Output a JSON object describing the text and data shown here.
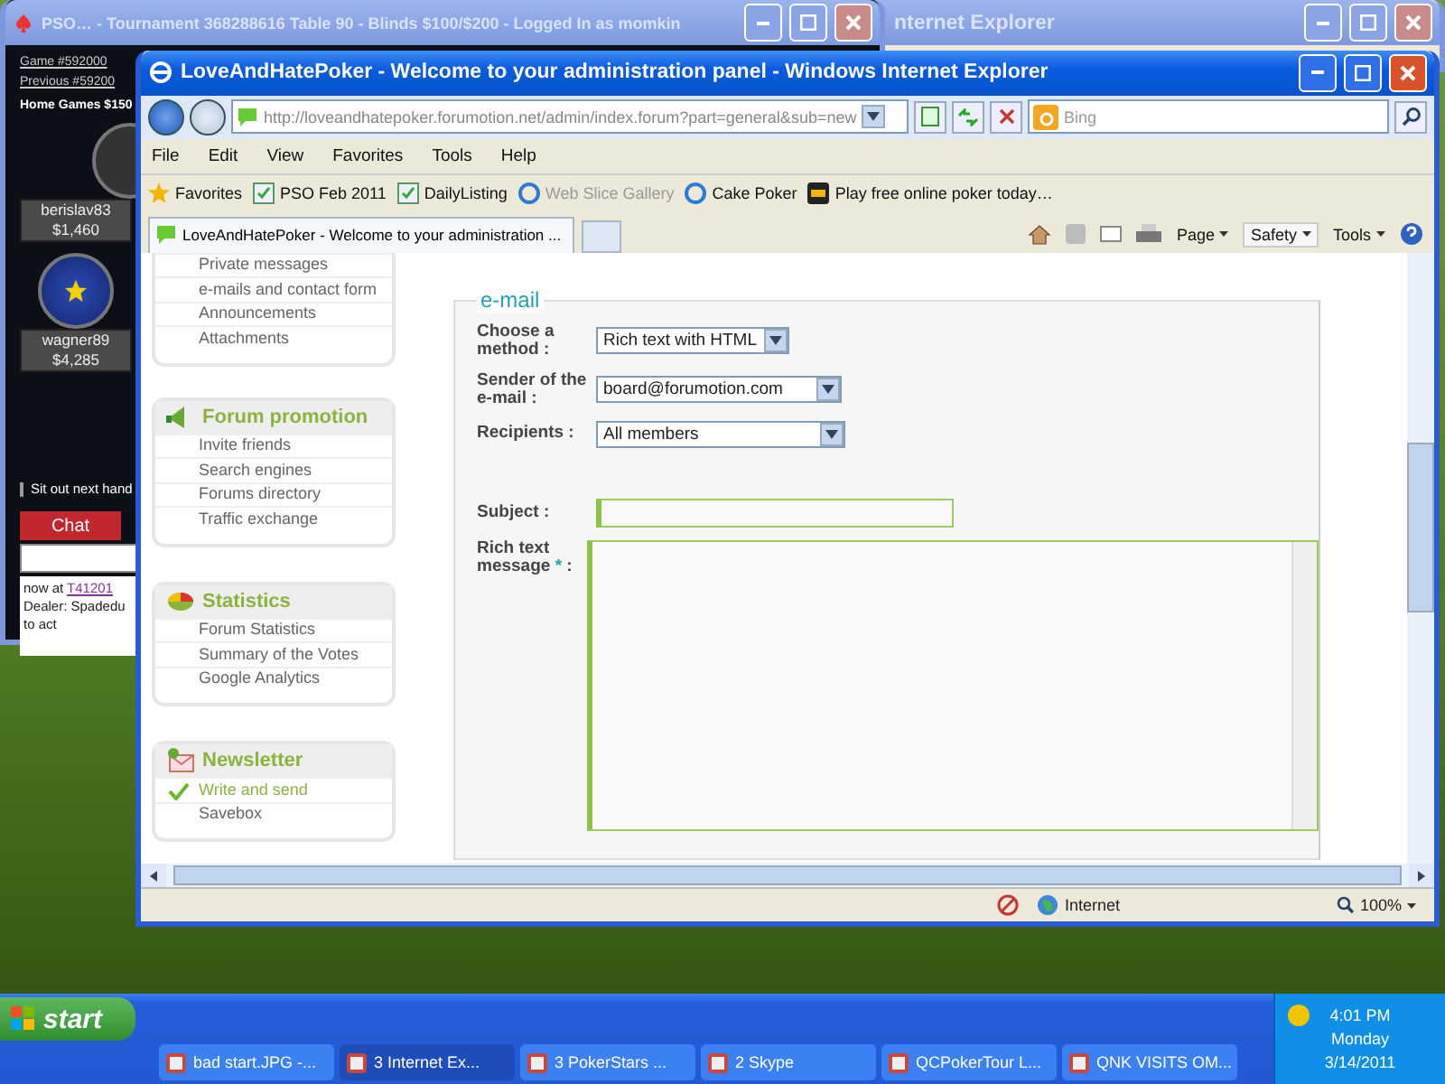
{
  "poker_window": {
    "title": "PSO… - Tournament 368288616 Table 90 - Blinds $100/$200 - Logged In as momkin",
    "active": false,
    "header_lines": [
      "Game  #592000",
      "Previous #59200"
    ],
    "table_name": "Home Games $150",
    "players": [
      {
        "name": "berislav83",
        "chips": "$1,460"
      },
      {
        "name": "wagner89",
        "chips": "$4,285"
      }
    ],
    "sit_out": {
      "label": "Sit out next hand",
      "checked": false
    },
    "chat_tab": "Chat",
    "chat_log": [
      {
        "text": "now at ",
        "link": "T41201"
      },
      {
        "text": "Dealer: Spadedu"
      },
      {
        "text": "to act"
      }
    ]
  },
  "back_window": {
    "title": "nternet Explorer",
    "active": false
  },
  "browser": {
    "title": "LoveAndHatePoker - Welcome to your administration panel - Windows Internet Explorer",
    "active": true,
    "address": "http://loveandhatepoker.forumotion.net/admin/index.forum?part=general&sub=new",
    "search_placeholder": "Bing",
    "menu": [
      "File",
      "Edit",
      "View",
      "Favorites",
      "Tools",
      "Help"
    ],
    "favorites": [
      {
        "label": "Favorites",
        "kind": "star",
        "disabled": false
      },
      {
        "label": "PSO Feb 2011",
        "kind": "feed",
        "disabled": false
      },
      {
        "label": "DailyListing",
        "kind": "feed",
        "disabled": false
      },
      {
        "label": "Web Slice Gallery",
        "kind": "page",
        "disabled": true
      },
      {
        "label": "Cake Poker",
        "kind": "page",
        "disabled": false
      },
      {
        "label": "Play free online poker today…",
        "kind": "logo",
        "disabled": false
      }
    ],
    "tab": {
      "label": "LoveAndHatePoker - Welcome to your administration ...",
      "selected": true
    },
    "commands": [
      "Page",
      "Safety",
      "Tools"
    ],
    "sidebar": [
      {
        "items": [
          {
            "label": "Private messages",
            "selected": false
          },
          {
            "label": "e-mails and contact form",
            "selected": false
          },
          {
            "label": "Announcements",
            "selected": false
          },
          {
            "label": "Attachments",
            "selected": false
          }
        ]
      },
      {
        "kind": "promotion",
        "title": "Forum promotion",
        "items": [
          {
            "label": "Invite friends",
            "selected": false
          },
          {
            "label": "Search engines",
            "selected": false
          },
          {
            "label": "Forums directory",
            "selected": false
          },
          {
            "label": "Traffic exchange",
            "selected": false
          }
        ]
      },
      {
        "kind": "statistics",
        "title": "Statistics",
        "items": [
          {
            "label": "Forum Statistics",
            "selected": false
          },
          {
            "label": "Summary of the Votes",
            "selected": false
          },
          {
            "label": "Google Analytics",
            "selected": false
          }
        ]
      },
      {
        "kind": "newsletter",
        "title": "Newsletter",
        "items": [
          {
            "label": "Write and send",
            "selected": true
          },
          {
            "label": "Savebox",
            "selected": false
          }
        ]
      }
    ],
    "form": {
      "legend": "e-mail",
      "fields": [
        {
          "kind": "select",
          "label": "Choose a method :",
          "value": "Rich text with HTML"
        },
        {
          "kind": "select",
          "label": "Sender of the e-mail :",
          "value": "board@forumotion.com"
        },
        {
          "kind": "select",
          "label": "Recipients :",
          "value": "All members"
        },
        {
          "kind": "input",
          "label": "Subject :"
        },
        {
          "kind": "textarea",
          "label": "Rich text message",
          "required_mark": "*",
          "suffix": ":"
        }
      ]
    },
    "status": {
      "zone": "Internet",
      "zoom": "100%"
    }
  },
  "taskbar": {
    "start": "start",
    "items": [
      {
        "label": "bad start.JPG -...",
        "selected": false
      },
      {
        "label": "3 Internet Ex...",
        "selected": true
      },
      {
        "label": "3 PokerStars ...",
        "selected": false
      },
      {
        "label": "2 Skype",
        "selected": false
      },
      {
        "label": "QCPokerTour L...",
        "selected": false
      },
      {
        "label": "QNK VISITS OM...",
        "selected": false
      }
    ],
    "clock": {
      "time": "4:01 PM",
      "day": "Monday",
      "date": "3/14/2011"
    }
  }
}
